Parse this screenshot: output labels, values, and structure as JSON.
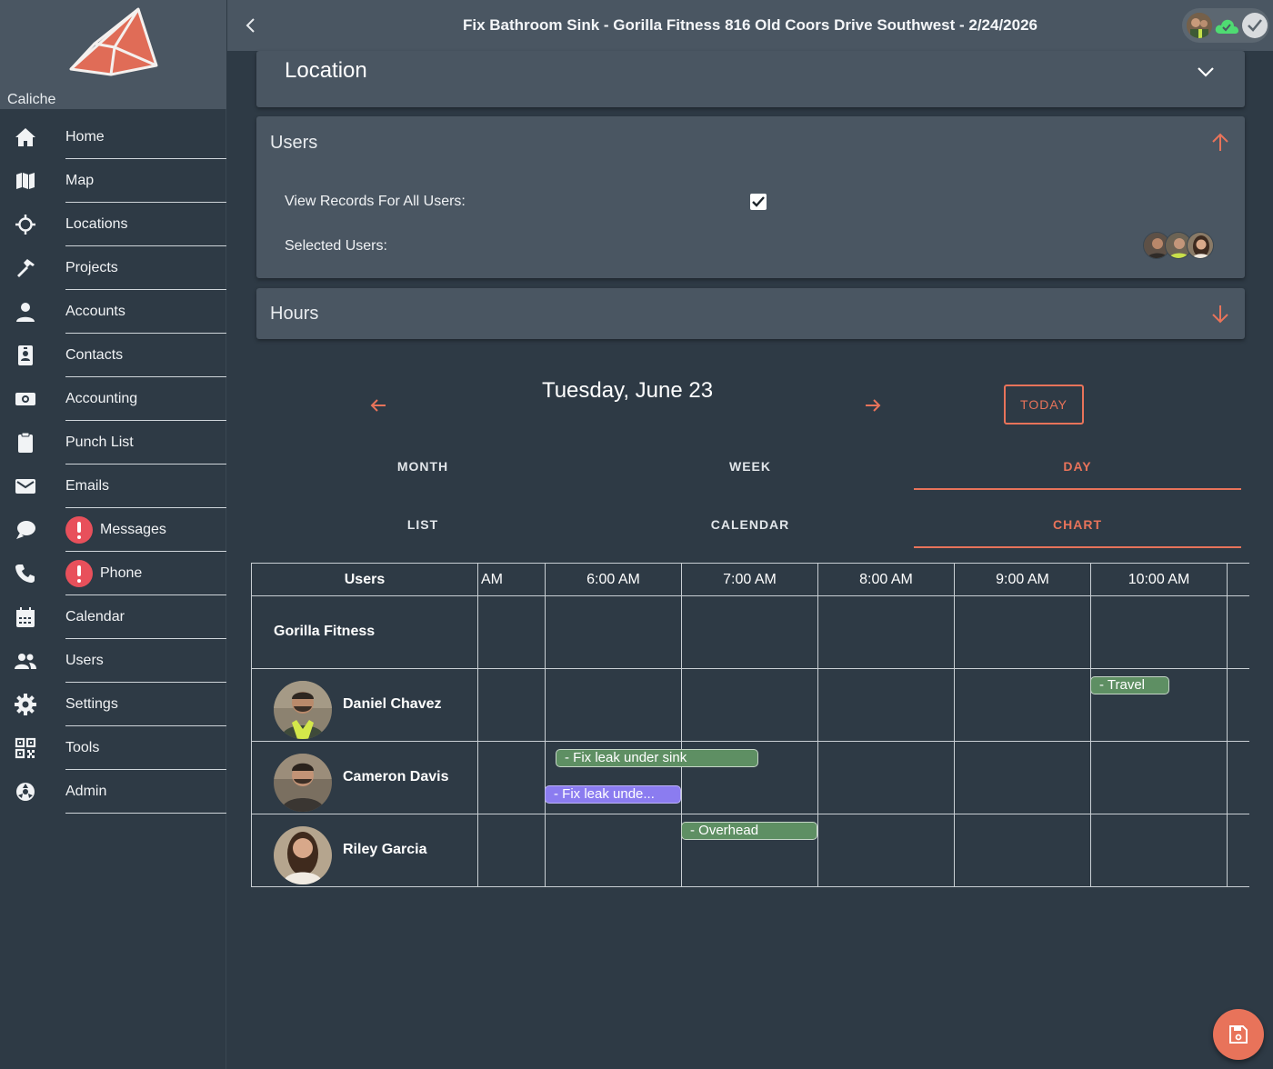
{
  "app": {
    "brand": "Caliche",
    "title": "Fix Bathroom Sink - Gorilla Fitness 816 Old Coors Drive Southwest - 2/24/2026",
    "accent_color": "#e8735a"
  },
  "sidebar": {
    "items": [
      {
        "label": "Home",
        "icon": "home-icon"
      },
      {
        "label": "Map",
        "icon": "map-icon"
      },
      {
        "label": "Locations",
        "icon": "crosshair-icon"
      },
      {
        "label": "Projects",
        "icon": "hammer-icon"
      },
      {
        "label": "Accounts",
        "icon": "person-icon"
      },
      {
        "label": "Contacts",
        "icon": "id-badge-icon"
      },
      {
        "label": "Accounting",
        "icon": "money-icon"
      },
      {
        "label": "Punch List",
        "icon": "clipboard-icon"
      },
      {
        "label": "Emails",
        "icon": "envelope-icon"
      },
      {
        "label": "Messages",
        "icon": "chat-icon",
        "alert": true
      },
      {
        "label": "Phone",
        "icon": "phone-icon",
        "alert": true
      },
      {
        "label": "Calendar",
        "icon": "calendar-icon"
      },
      {
        "label": "Users",
        "icon": "users-icon"
      },
      {
        "label": "Settings",
        "icon": "gear-icon"
      },
      {
        "label": "Tools",
        "icon": "qr-code-icon"
      },
      {
        "label": "Admin",
        "icon": "admin-icon"
      }
    ]
  },
  "location_card": {
    "title": "Location"
  },
  "users_card": {
    "title": "Users",
    "view_all_label": "View Records For All Users:",
    "view_all_checked": true,
    "selected_label": "Selected Users:"
  },
  "hours_card": {
    "title": "Hours"
  },
  "calendar": {
    "date_heading": "Tuesday, June 23",
    "today_label": "TODAY",
    "view_tabs": [
      "MONTH",
      "WEEK",
      "DAY"
    ],
    "active_view": "DAY",
    "mode_tabs": [
      "LIST",
      "CALENDAR",
      "CHART"
    ],
    "active_mode": "CHART"
  },
  "chart": {
    "users_header": "Users",
    "time_headers": [
      "AM",
      "6:00 AM",
      "7:00 AM",
      "8:00 AM",
      "9:00 AM",
      "10:00 AM"
    ],
    "rows": [
      {
        "name": "Gorilla Fitness",
        "type": "location"
      },
      {
        "name": "Daniel Chavez",
        "type": "user",
        "avatar": "avatar-daniel"
      },
      {
        "name": "Cameron Davis",
        "type": "user",
        "avatar": "avatar-cameron"
      },
      {
        "name": "Riley Garcia",
        "type": "user",
        "avatar": "avatar-riley"
      }
    ],
    "events": [
      {
        "row": 1,
        "label": "- Travel",
        "start": "10:00 AM",
        "end": "10:35 AM",
        "color": "green"
      },
      {
        "row": 2,
        "label": "- Fix leak under sink",
        "start": "6:05 AM",
        "end": "7:34 AM",
        "color": "green"
      },
      {
        "row": 2,
        "label": "- Fix leak unde...",
        "start": "6:00 AM",
        "end": "7:00 AM",
        "color": "purple"
      },
      {
        "row": 3,
        "label": "- Overhead",
        "start": "7:00 AM",
        "end": "8:00 AM",
        "color": "green"
      }
    ]
  }
}
